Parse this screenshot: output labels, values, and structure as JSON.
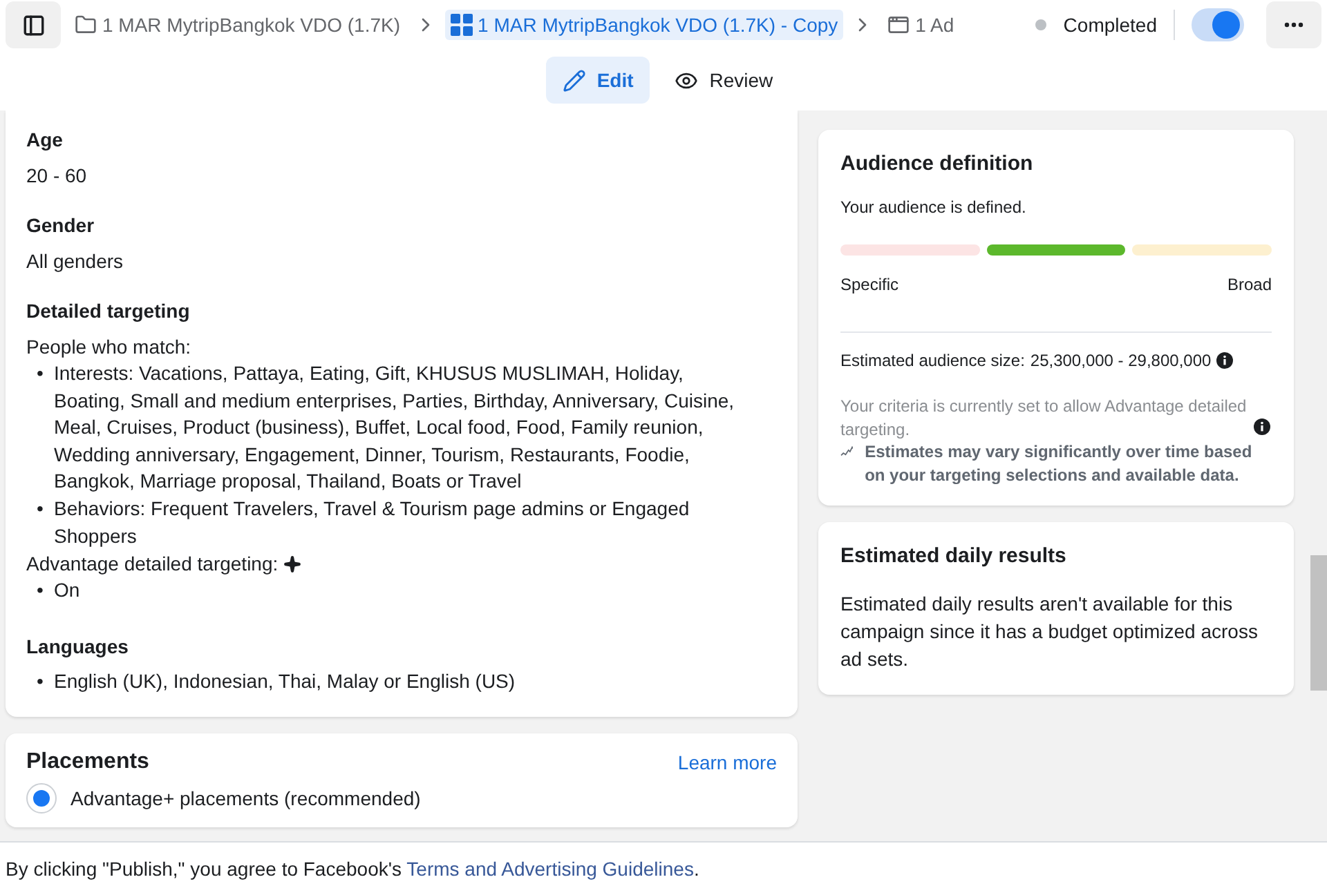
{
  "breadcrumbs": [
    {
      "kind": "folder",
      "label": "1 MAR MytripBangkok VDO (1.7K)",
      "selected": false
    },
    {
      "kind": "grid",
      "label": "1 MAR MytripBangkok VDO (1.7K) - Copy",
      "selected": true
    },
    {
      "kind": "ad",
      "label": "1 Ad",
      "selected": false
    }
  ],
  "status": {
    "label": "Completed",
    "color": "#bcc0c4"
  },
  "toggle": {
    "on": true
  },
  "tabs": [
    {
      "kind": "edit",
      "label": "Edit",
      "selected": true
    },
    {
      "kind": "review",
      "label": "Review",
      "selected": false
    }
  ],
  "audience": [
    {
      "heading": "Age",
      "value": "20 - 60"
    },
    {
      "heading": "Gender",
      "value": "All genders"
    }
  ],
  "detailed_targeting": {
    "bullet": "•",
    "heading": "Detailed targeting",
    "intro": "People who match:",
    "items": [
      "Interests: Vacations, Pattaya, Eating, Gift, KHUSUS MUSLIMAH, Holiday, Boating, Small and medium enterprises, Parties, Birthday, Anniversary, Cuisine, Meal, Cruises, Product (business), Buffet, Local food, Food, Family reunion, Wedding anniversary, Engagement, Dinner, Tourism, Restaurants, Foodie, Bangkok, Marriage proposal, Thailand, Boats or Travel",
      "Behaviors: Frequent Travelers, Travel & Tourism page admins or Engaged Shoppers"
    ],
    "advantage_label": "Advantage detailed targeting:",
    "advantage_items": [
      "On"
    ]
  },
  "languages": {
    "bullet": "•",
    "heading": "Languages",
    "items": [
      "English (UK), Indonesian, Thai, Malay or English (US)"
    ]
  },
  "placements": {
    "title": "Placements",
    "link": "Learn more",
    "option": {
      "label": "Advantage+ placements (recommended)",
      "selected": true
    }
  },
  "audience_definition": {
    "title": "Audience definition",
    "subtitle": "Your audience is defined.",
    "segments": [
      {
        "color": "#fce4e4"
      },
      {
        "color": "#5cb82c"
      },
      {
        "color": "#fdf0cf"
      }
    ],
    "low_label": "Specific",
    "high_label": "Broad",
    "size_label": "Estimated audience size:",
    "size_value": "25,300,000 - 29,800,000",
    "criteria": "Your criteria is currently set to allow Advantage detailed targeting.",
    "note": "Estimates may vary significantly over time based on your targeting selections and available data."
  },
  "daily_results": {
    "title": "Estimated daily results",
    "text": "Estimated daily results aren't available for this campaign since it has a budget optimized across ad sets."
  },
  "footer": {
    "text": "By clicking \"Publish,\" you agree to Facebook's ",
    "link": "Terms and Advertising Guidelines",
    "end": "."
  }
}
